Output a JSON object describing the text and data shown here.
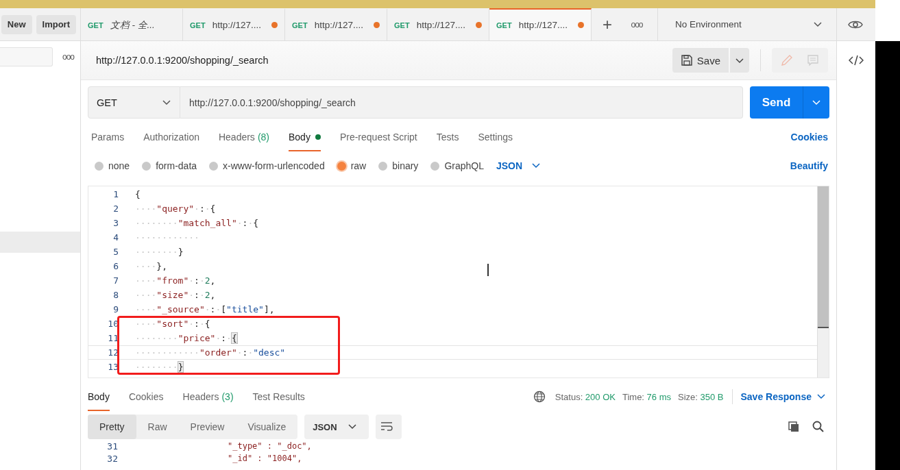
{
  "sidebar": {
    "buttons": [
      "New",
      "Import"
    ],
    "more": "ooo"
  },
  "tabs": [
    {
      "method": "GET",
      "label": "文档 - 全...",
      "italic": true,
      "unsaved": false,
      "selected": false
    },
    {
      "method": "GET",
      "label": "http://127....",
      "italic": false,
      "unsaved": true,
      "selected": false
    },
    {
      "method": "GET",
      "label": "http://127....",
      "italic": false,
      "unsaved": true,
      "selected": false
    },
    {
      "method": "GET",
      "label": "http://127....",
      "italic": false,
      "unsaved": true,
      "selected": false
    },
    {
      "method": "GET",
      "label": "http://127....",
      "italic": false,
      "unsaved": true,
      "selected": true
    }
  ],
  "tab_actions": {
    "add": "+",
    "more": "ooo"
  },
  "environment": "No Environment",
  "request_title": "http://127.0.0.1:9200/shopping/_search",
  "save_label": "Save",
  "method": "GET",
  "url": "http://127.0.0.1:9200/shopping/_search",
  "send_label": "Send",
  "request_tabs": [
    {
      "label": "Params",
      "dot": false,
      "selected": false
    },
    {
      "label": "Authorization",
      "dot": false,
      "selected": false
    },
    {
      "label": "Headers",
      "count": "(8)",
      "dot": false,
      "selected": false
    },
    {
      "label": "Body",
      "dot": true,
      "selected": true
    },
    {
      "label": "Pre-request Script",
      "dot": false,
      "selected": false
    },
    {
      "label": "Tests",
      "dot": false,
      "selected": false
    },
    {
      "label": "Settings",
      "dot": false,
      "selected": false
    }
  ],
  "cookies_link": "Cookies",
  "body_types": [
    {
      "label": "none",
      "selected": false
    },
    {
      "label": "form-data",
      "selected": false
    },
    {
      "label": "x-www-form-urlencoded",
      "selected": false
    },
    {
      "label": "raw",
      "selected": true
    },
    {
      "label": "binary",
      "selected": false
    },
    {
      "label": "GraphQL",
      "selected": false
    }
  ],
  "body_format": "JSON",
  "beautify_link": "Beautify",
  "code_lines": [
    {
      "number": "1",
      "tokens": [
        {
          "kind": "punct",
          "text": "{"
        }
      ]
    },
    {
      "number": "2",
      "tokens": [
        {
          "kind": "ws",
          "text": "····"
        },
        {
          "kind": "key",
          "text": "\"query\""
        },
        {
          "kind": "ws",
          "text": "·"
        },
        {
          "kind": "punct",
          "text": ":"
        },
        {
          "kind": "ws",
          "text": "·"
        },
        {
          "kind": "punct",
          "text": "{"
        }
      ]
    },
    {
      "number": "3",
      "tokens": [
        {
          "kind": "ws",
          "text": "········"
        },
        {
          "kind": "key",
          "text": "\"match_all\""
        },
        {
          "kind": "ws",
          "text": "·"
        },
        {
          "kind": "punct",
          "text": ":"
        },
        {
          "kind": "ws",
          "text": "·"
        },
        {
          "kind": "punct",
          "text": "{"
        }
      ]
    },
    {
      "number": "4",
      "tokens": [
        {
          "kind": "ws",
          "text": "············"
        }
      ]
    },
    {
      "number": "5",
      "tokens": [
        {
          "kind": "ws",
          "text": "········"
        },
        {
          "kind": "punct",
          "text": "}"
        }
      ]
    },
    {
      "number": "6",
      "tokens": [
        {
          "kind": "ws",
          "text": "····"
        },
        {
          "kind": "punct",
          "text": "},"
        }
      ]
    },
    {
      "number": "7",
      "tokens": [
        {
          "kind": "ws",
          "text": "····"
        },
        {
          "kind": "key",
          "text": "\"from\""
        },
        {
          "kind": "ws",
          "text": "·"
        },
        {
          "kind": "punct",
          "text": ":"
        },
        {
          "kind": "ws",
          "text": "·"
        },
        {
          "kind": "num",
          "text": "2"
        },
        {
          "kind": "punct",
          "text": ","
        }
      ]
    },
    {
      "number": "8",
      "tokens": [
        {
          "kind": "ws",
          "text": "····"
        },
        {
          "kind": "key",
          "text": "\"size\""
        },
        {
          "kind": "ws",
          "text": "·"
        },
        {
          "kind": "punct",
          "text": ":"
        },
        {
          "kind": "ws",
          "text": "·"
        },
        {
          "kind": "num",
          "text": "2"
        },
        {
          "kind": "punct",
          "text": ","
        }
      ]
    },
    {
      "number": "9",
      "tokens": [
        {
          "kind": "ws",
          "text": "····"
        },
        {
          "kind": "key",
          "text": "\"_source\""
        },
        {
          "kind": "ws",
          "text": "·"
        },
        {
          "kind": "punct",
          "text": ":"
        },
        {
          "kind": "ws",
          "text": "·"
        },
        {
          "kind": "punct",
          "text": "["
        },
        {
          "kind": "str",
          "text": "\"title\""
        },
        {
          "kind": "punct",
          "text": "],"
        }
      ]
    },
    {
      "number": "10",
      "tokens": [
        {
          "kind": "ws",
          "text": "····"
        },
        {
          "kind": "key",
          "text": "\"sort\""
        },
        {
          "kind": "ws",
          "text": "·"
        },
        {
          "kind": "punct",
          "text": ":"
        },
        {
          "kind": "ws",
          "text": "·"
        },
        {
          "kind": "punct",
          "text": "{"
        }
      ]
    },
    {
      "number": "11",
      "tokens": [
        {
          "kind": "ws",
          "text": "········"
        },
        {
          "kind": "key",
          "text": "\"price\""
        },
        {
          "kind": "ws",
          "text": "·"
        },
        {
          "kind": "punct",
          "text": ":"
        },
        {
          "kind": "ws",
          "text": "·"
        },
        {
          "kind": "match",
          "text": "{"
        }
      ]
    },
    {
      "number": "12",
      "tokens": [
        {
          "kind": "ws",
          "text": "············"
        },
        {
          "kind": "key",
          "text": "\"order\""
        },
        {
          "kind": "ws",
          "text": "·"
        },
        {
          "kind": "punct",
          "text": ":"
        },
        {
          "kind": "ws",
          "text": "·"
        },
        {
          "kind": "str",
          "text": "\"desc\""
        }
      ]
    },
    {
      "number": "13",
      "tokens": [
        {
          "kind": "ws",
          "text": "········"
        },
        {
          "kind": "match",
          "text": "}"
        }
      ]
    }
  ],
  "response_tabs": [
    {
      "label": "Body",
      "selected": true
    },
    {
      "label": "Cookies",
      "selected": false
    },
    {
      "label": "Headers",
      "count": "(3)",
      "selected": false
    },
    {
      "label": "Test Results",
      "selected": false
    }
  ],
  "response_meta": [
    {
      "label": "Status:",
      "value": "200 OK"
    },
    {
      "label": "Time:",
      "value": "76 ms"
    },
    {
      "label": "Size:",
      "value": "350 B"
    }
  ],
  "save_response": "Save Response",
  "view_modes": [
    {
      "label": "Pretty",
      "selected": true
    },
    {
      "label": "Raw",
      "selected": false
    },
    {
      "label": "Preview",
      "selected": false
    },
    {
      "label": "Visualize",
      "selected": false
    }
  ],
  "response_format": "JSON",
  "response_lines": [
    {
      "number": "31",
      "text": "\"_type\" : \"_doc\","
    },
    {
      "number": "32",
      "text": "\"_id\" : \"1004\","
    }
  ]
}
